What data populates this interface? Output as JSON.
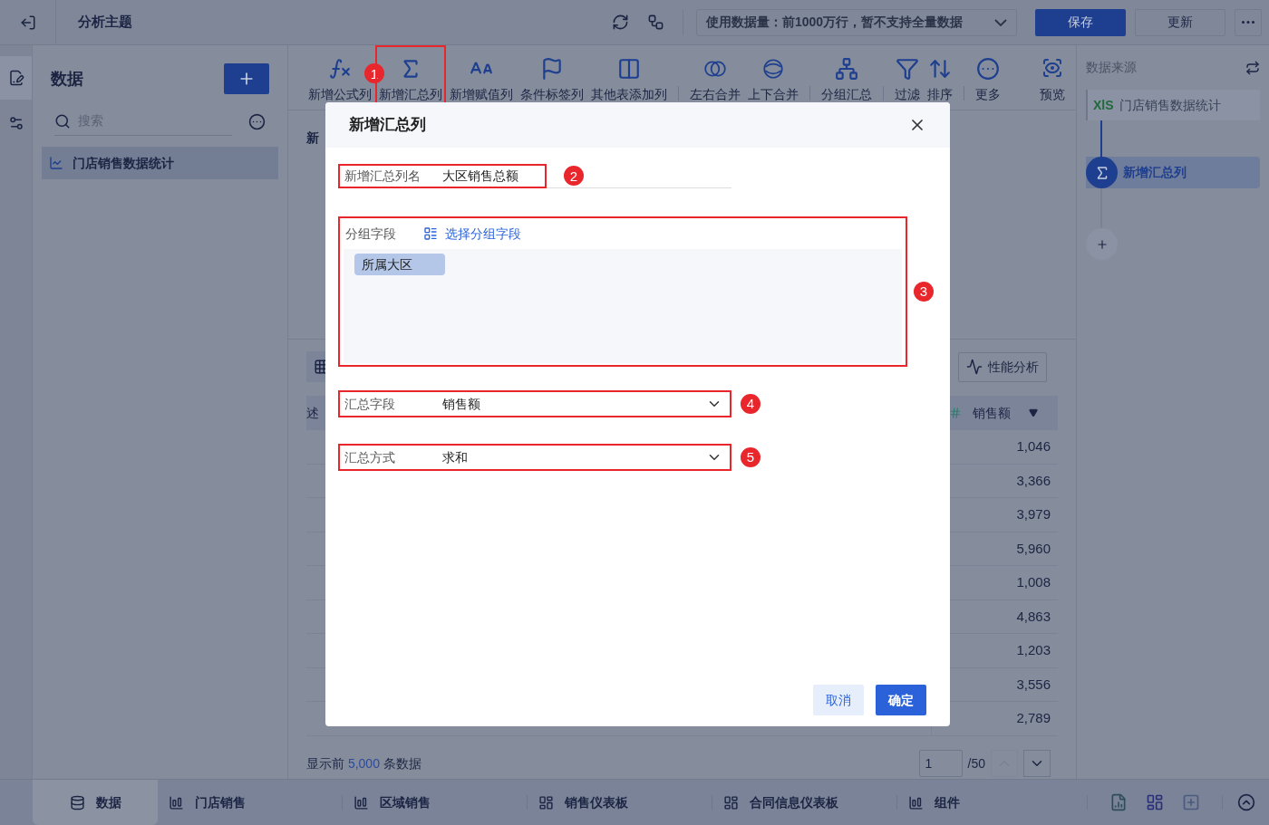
{
  "topbar": {
    "title": "分析主题",
    "data_limit": "使用数据量：前1000万行，暂不支持全量数据",
    "buttons": [
      {
        "label": "保存",
        "kind": "primary"
      },
      {
        "label": "更新",
        "kind": "default"
      }
    ]
  },
  "side_nav": [
    {
      "selected": true
    },
    {
      "selected": false
    }
  ],
  "data_panel": {
    "title": "数据",
    "search": {
      "placeholder": "搜索"
    },
    "items": [
      {
        "label": "门店销售数据统计",
        "selected": true
      }
    ]
  },
  "toolbar": {
    "items": [
      {
        "label": "新增公式列",
        "highlighted": false,
        "badge": "1",
        "separator_after": false
      },
      {
        "label": "新增汇总列",
        "highlighted": true,
        "separator_after": false
      },
      {
        "label": "新增赋值列",
        "highlighted": false,
        "separator_after": false
      },
      {
        "label": "条件标签列",
        "highlighted": false,
        "separator_after": false
      },
      {
        "label": "其他表添加列",
        "highlighted": false,
        "separator_after": true
      },
      {
        "label": "左右合并",
        "highlighted": false,
        "separator_after": false
      },
      {
        "label": "上下合并",
        "highlighted": false,
        "separator_after": true
      },
      {
        "label": "分组汇总",
        "highlighted": false,
        "separator_after": true
      },
      {
        "label": "过滤",
        "highlighted": false,
        "separator_after": false
      },
      {
        "label": "排序",
        "highlighted": false,
        "separator_after": true
      },
      {
        "label": "更多",
        "highlighted": false,
        "separator_after": false
      }
    ],
    "preview": {
      "label": "预览"
    }
  },
  "canvas": {
    "title": "新"
  },
  "table": {
    "perf_button": "性能分析",
    "columns": [
      {
        "label": "述"
      },
      {
        "label": "销售额"
      }
    ],
    "rows": [
      {
        "sales": "1,046"
      },
      {
        "sales": "3,366"
      },
      {
        "sales": "3,979"
      },
      {
        "sales": "5,960"
      },
      {
        "sales": "1,008"
      },
      {
        "sales": "4,863"
      },
      {
        "sales": "1,203"
      },
      {
        "sales": "3,556"
      },
      {
        "sales": "2,789"
      }
    ]
  },
  "footer": {
    "prefix": "显示前",
    "count": "5,000",
    "suffix": "条数据",
    "page": "1",
    "total": "/50"
  },
  "lineage": {
    "title": "数据来源",
    "source": {
      "file_type": "XlS",
      "label": "门店销售数据统计"
    },
    "steps": [
      {
        "label": "新增汇总列",
        "selected": true
      }
    ]
  },
  "bottom_tabs": [
    {
      "label": "数据",
      "selected": true
    },
    {
      "label": "门店销售",
      "selected": false
    },
    {
      "label": "区域销售",
      "selected": false
    },
    {
      "label": "销售仪表板",
      "selected": false
    },
    {
      "label": "合同信息仪表板",
      "selected": false
    },
    {
      "label": "组件",
      "selected": false
    }
  ],
  "dialog": {
    "title": "新增汇总列",
    "name_field": {
      "label": "新增汇总列名",
      "value": "大区销售总额",
      "badge": "2"
    },
    "group_field": {
      "label": "分组字段",
      "link": "选择分组字段",
      "chips": [
        "所属大区"
      ],
      "badge": "3"
    },
    "selects": [
      {
        "label": "汇总字段",
        "value": "销售额",
        "badge": "4"
      },
      {
        "label": "汇总方式",
        "value": "求和",
        "badge": "5"
      }
    ],
    "buttons": [
      {
        "label": "取消",
        "kind": "secondary"
      },
      {
        "label": "确定",
        "kind": "primary"
      }
    ]
  }
}
